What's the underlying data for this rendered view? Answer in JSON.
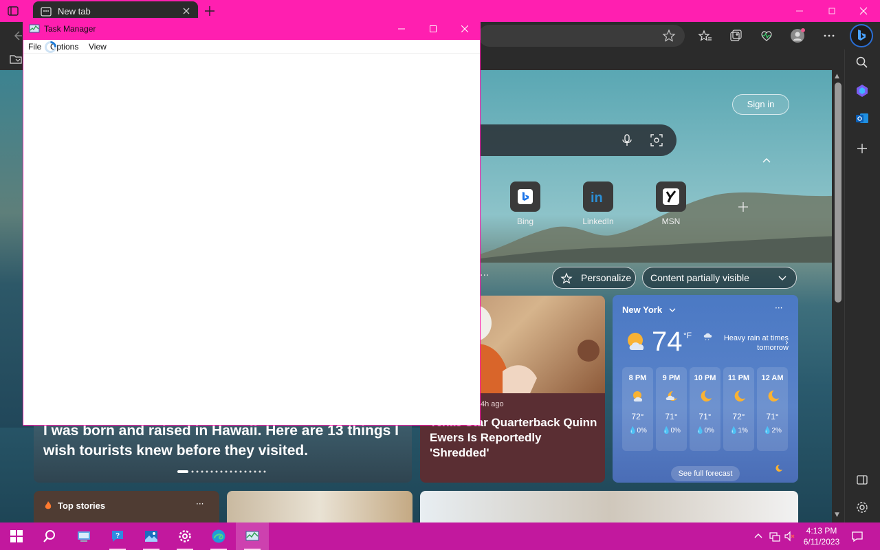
{
  "browser": {
    "tab_title": "New tab",
    "colors": {
      "accent": "#ff1fb0",
      "taskbar": "#c2189e",
      "dark": "#2b2b2b"
    }
  },
  "ntp": {
    "sign_in_label": "Sign in",
    "tiles": [
      {
        "label": "Bing",
        "icon": "bing-icon"
      },
      {
        "label": "LinkedIn",
        "icon": "linkedin-icon"
      },
      {
        "label": "MSN",
        "icon": "msn-icon"
      }
    ],
    "personalize_label": "Personalize",
    "content_visibility_label": "Content partially visible",
    "main_story": {
      "headline": "I was born and raised in Hawaii. Here are 13 things I wish tourists knew before they visited."
    },
    "qb_story": {
      "time": "4h ago",
      "headline": "Texas Star Quarterback Quinn Ewers Is Reportedly 'Shredded'"
    },
    "weather": {
      "city": "New York",
      "temp": "74",
      "unit": "°F",
      "condition": "Heavy rain at times tomorrow",
      "forecast_button": "See full forecast",
      "hours": [
        {
          "time": "8 PM",
          "temp": "72°",
          "precip": "0%",
          "icon": "partly-cloudy-icon"
        },
        {
          "time": "9 PM",
          "temp": "71°",
          "precip": "0%",
          "icon": "partly-cloudy-night-icon"
        },
        {
          "time": "10 PM",
          "temp": "71°",
          "precip": "0%",
          "icon": "moon-icon"
        },
        {
          "time": "11 PM",
          "temp": "72°",
          "precip": "1%",
          "icon": "moon-icon"
        },
        {
          "time": "12 AM",
          "temp": "71°",
          "precip": "2%",
          "icon": "moon-icon"
        }
      ]
    },
    "top_stories_label": "Top stories"
  },
  "task_manager": {
    "title": "Task Manager",
    "menu": {
      "file": "File",
      "options": "Options",
      "view": "View"
    }
  },
  "taskbar": {
    "time": "4:13 PM",
    "date": "6/11/2023"
  }
}
